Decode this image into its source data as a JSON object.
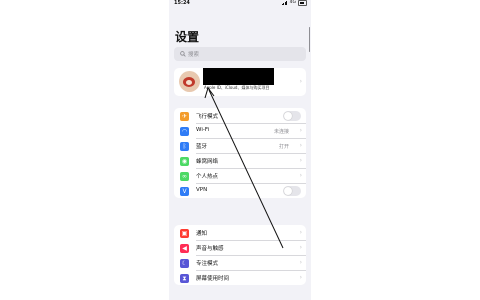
{
  "status_bar": {
    "time": "15:24",
    "network": "4G"
  },
  "header": {
    "title": "设置"
  },
  "search": {
    "placeholder": "搜索"
  },
  "account": {
    "subtitle": "Apple ID、iCloud、媒体与购买项目"
  },
  "network_group": [
    {
      "label": "飞行模式",
      "icon": "airplane-icon",
      "color": "#f39c2c",
      "glyph": "✈"
    },
    {
      "label": "Wi-Fi",
      "value": "未连接",
      "icon": "wifi-icon",
      "color": "#2f7cf6",
      "glyph": "◠"
    },
    {
      "label": "蓝牙",
      "value": "打开",
      "icon": "bluetooth-icon",
      "color": "#2f7cf6",
      "glyph": "ᛒ"
    },
    {
      "label": "蜂窝网络",
      "icon": "cellular-icon",
      "color": "#4cd964",
      "glyph": "◉"
    },
    {
      "label": "个人热点",
      "icon": "hotspot-icon",
      "color": "#4cd964",
      "glyph": "∞"
    },
    {
      "label": "VPN",
      "icon": "vpn-icon",
      "color": "#2f7cf6",
      "glyph": "V"
    }
  ],
  "notification_group": [
    {
      "label": "通知",
      "icon": "bell-icon",
      "color": "#ff3b30",
      "glyph": "▣"
    },
    {
      "label": "声音与触感",
      "icon": "speaker-icon",
      "color": "#ff2d55",
      "glyph": "◀"
    },
    {
      "label": "专注模式",
      "icon": "moon-icon",
      "color": "#5856d6",
      "glyph": "☾"
    },
    {
      "label": "屏幕使用时间",
      "icon": "hourglass-icon",
      "color": "#5856d6",
      "glyph": "⧗"
    }
  ]
}
